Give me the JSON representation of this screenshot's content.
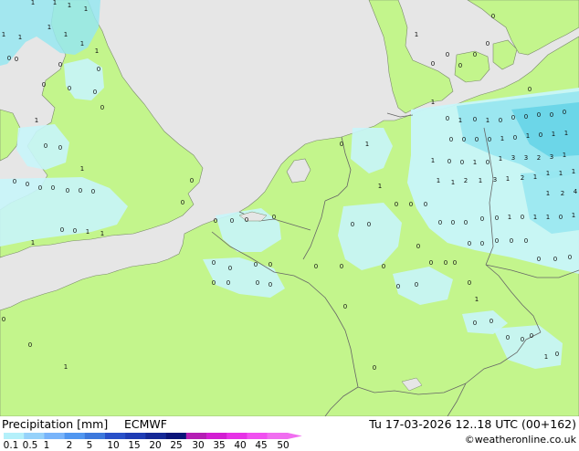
{
  "footer": {
    "title": "Precipitation [mm]",
    "model": "ECMWF",
    "valid": "Tu 17-03-2026 12..18 UTC (00+162)",
    "credit": "©weatheronline.co.uk"
  },
  "legend": {
    "ticks": [
      "0.1",
      "0.5",
      "1",
      "2",
      "5",
      "10",
      "15",
      "20",
      "25",
      "30",
      "35",
      "40",
      "45",
      "50"
    ],
    "colors": [
      "#b4f0fa",
      "#96d2fa",
      "#78b4fa",
      "#5096f0",
      "#3c78dc",
      "#2850c8",
      "#1e3cb4",
      "#142896",
      "#0a1478",
      "#b41eb4",
      "#d21ed2",
      "#e632e6",
      "#f050f0",
      "#f06ef0"
    ]
  },
  "map": {
    "colors": {
      "sea": "#e6e6e6",
      "land": "#c3f58c",
      "rain_light": "#c8f5fa",
      "rain_moderate": "#96e6f0",
      "rain_heavy": "#64d2e6",
      "border": "#666666"
    },
    "labels": [
      {
        "t": "1"
      },
      {
        "t": "1"
      },
      {
        "t": "1"
      },
      {
        "t": "1"
      },
      {
        "t": "1"
      },
      {
        "t": "1"
      },
      {
        "t": "1"
      },
      {
        "t": "1"
      },
      {
        "t": "1"
      },
      {
        "t": "1"
      },
      {
        "t": "0"
      },
      {
        "t": "0"
      },
      {
        "t": "0"
      },
      {
        "t": "0"
      },
      {
        "t": "0"
      },
      {
        "t": "0"
      },
      {
        "t": "0"
      },
      {
        "t": "0"
      },
      {
        "t": "1"
      },
      {
        "t": "0"
      },
      {
        "t": "0"
      },
      {
        "t": "1"
      },
      {
        "t": "0"
      },
      {
        "t": "0"
      },
      {
        "t": "0"
      },
      {
        "t": "0"
      },
      {
        "t": "0"
      },
      {
        "t": "0"
      },
      {
        "t": "0"
      },
      {
        "t": "0"
      },
      {
        "t": "0"
      },
      {
        "t": "1"
      },
      {
        "t": "0"
      },
      {
        "t": "0"
      },
      {
        "t": "1"
      },
      {
        "t": "1"
      },
      {
        "t": "0"
      },
      {
        "t": "0"
      },
      {
        "t": "0"
      },
      {
        "t": "0"
      },
      {
        "t": "0"
      },
      {
        "t": "1"
      },
      {
        "t": "1"
      },
      {
        "t": "0"
      },
      {
        "t": "1"
      },
      {
        "t": "0"
      },
      {
        "t": "1"
      },
      {
        "t": "0"
      },
      {
        "t": "0"
      },
      {
        "t": "0"
      },
      {
        "t": "0"
      },
      {
        "t": "0"
      },
      {
        "t": "0"
      },
      {
        "t": "0"
      },
      {
        "t": "0"
      },
      {
        "t": "0"
      },
      {
        "t": "0"
      },
      {
        "t": "1"
      },
      {
        "t": "0"
      },
      {
        "t": "1"
      },
      {
        "t": "0"
      },
      {
        "t": "1"
      },
      {
        "t": "1"
      },
      {
        "t": "1"
      },
      {
        "t": "0"
      },
      {
        "t": "0"
      },
      {
        "t": "1"
      },
      {
        "t": "0"
      },
      {
        "t": "1"
      },
      {
        "t": "3"
      },
      {
        "t": "3"
      },
      {
        "t": "2"
      },
      {
        "t": "3"
      },
      {
        "t": "1"
      },
      {
        "t": "1"
      },
      {
        "t": "1"
      },
      {
        "t": "2"
      },
      {
        "t": "1"
      },
      {
        "t": "3"
      },
      {
        "t": "1"
      },
      {
        "t": "2"
      },
      {
        "t": "1"
      },
      {
        "t": "1"
      },
      {
        "t": "1"
      },
      {
        "t": "1"
      },
      {
        "t": "1"
      },
      {
        "t": "2"
      },
      {
        "t": "4"
      },
      {
        "t": "1"
      },
      {
        "t": "1"
      },
      {
        "t": "0"
      },
      {
        "t": "1"
      },
      {
        "t": "0"
      },
      {
        "t": "0"
      },
      {
        "t": "0"
      },
      {
        "t": "0"
      },
      {
        "t": "0"
      },
      {
        "t": "0"
      },
      {
        "t": "0"
      },
      {
        "t": "0"
      },
      {
        "t": "1"
      },
      {
        "t": "0"
      },
      {
        "t": "0"
      },
      {
        "t": "0"
      },
      {
        "t": "1"
      },
      {
        "t": "0"
      },
      {
        "t": "0"
      },
      {
        "t": "0"
      },
      {
        "t": "0"
      },
      {
        "t": "0"
      },
      {
        "t": "0"
      },
      {
        "t": "0"
      },
      {
        "t": "0"
      },
      {
        "t": "0"
      },
      {
        "t": "0"
      },
      {
        "t": "0"
      },
      {
        "t": "0"
      },
      {
        "t": "0"
      },
      {
        "t": "0"
      },
      {
        "t": "0"
      },
      {
        "t": "0"
      },
      {
        "t": "0"
      },
      {
        "t": "0"
      },
      {
        "t": "0"
      },
      {
        "t": "0"
      },
      {
        "t": "0"
      },
      {
        "t": "0"
      },
      {
        "t": "0"
      },
      {
        "t": "0"
      },
      {
        "t": "0"
      },
      {
        "t": "0"
      },
      {
        "t": "1"
      },
      {
        "t": "0"
      },
      {
        "t": "0"
      },
      {
        "t": "0"
      },
      {
        "t": "0"
      },
      {
        "t": "0"
      },
      {
        "t": "0"
      },
      {
        "t": "1"
      },
      {
        "t": "0"
      },
      {
        "t": "0"
      },
      {
        "t": "0"
      },
      {
        "t": "0"
      },
      {
        "t": "1"
      },
      {
        "t": "1"
      },
      {
        "t": "0"
      },
      {
        "t": "0"
      },
      {
        "t": "0"
      },
      {
        "t": "0"
      },
      {
        "t": "0"
      },
      {
        "t": "0"
      },
      {
        "t": "0"
      }
    ]
  }
}
